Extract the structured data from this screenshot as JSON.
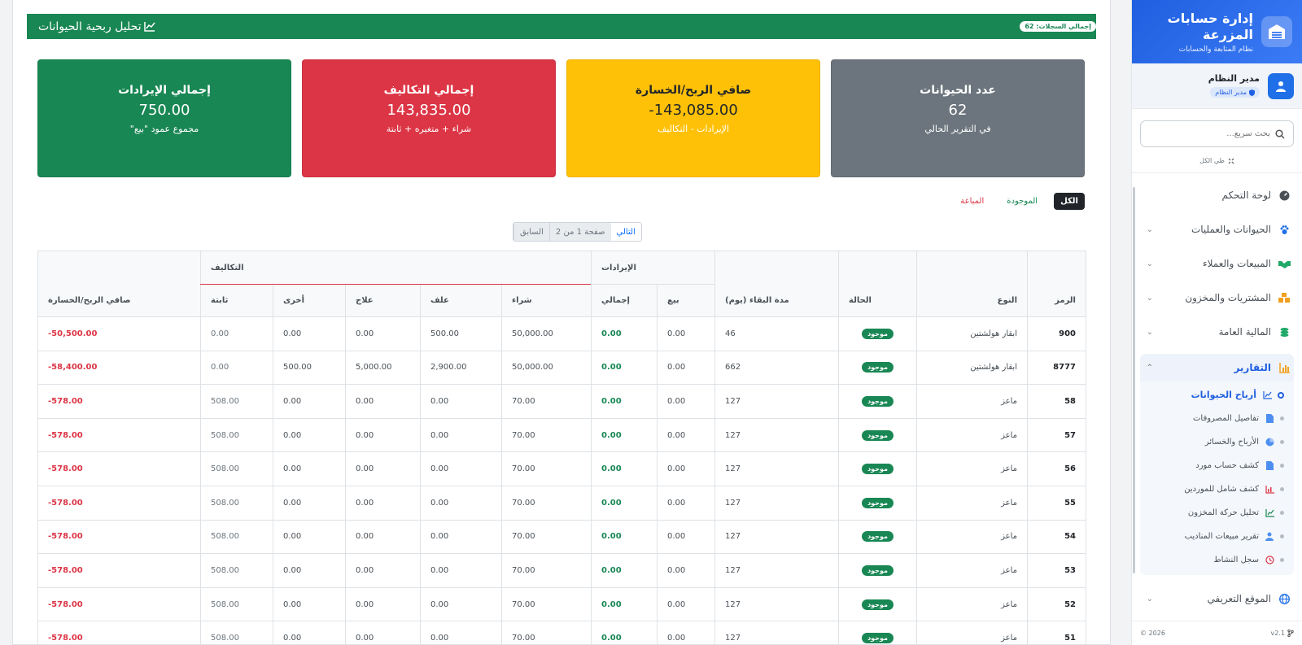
{
  "sidebar": {
    "brand_title": "إدارة حسابات المزرعة",
    "brand_subtitle": "نظام المتابعة والحسابات",
    "user_name": "مدير النظام",
    "user_role": "مدير النظام",
    "search_placeholder": "بحث سريع...",
    "collapse_all": "طي الكل",
    "menu": {
      "dashboard": "لوحة التحكم",
      "animals": "الحيوانات والعمليات",
      "sales": "المبيعات والعملاء",
      "purchases": "المشتريات والمخزون",
      "finance": "المالية العامة",
      "reports": "التقارير",
      "website": "الموقع التعريفي"
    },
    "reports_sub": [
      "أرباح الحيوانات",
      "تفاصيل المصروفات",
      "الأرباح والخسائر",
      "كشف حساب مورد",
      "كشف شامل للموردين",
      "تحليل حركة المخزون",
      "تقرير مبيعات المناديب",
      "سجل النشاط"
    ],
    "version": "v2.1",
    "copyright": "© 2026"
  },
  "header": {
    "title": "تحليل ربحية الحيوانات",
    "total_badge": "إجمالي السجلات: 62"
  },
  "cards": [
    {
      "title": "إجمالي الإيرادات",
      "value": "750.00",
      "sub": "مجموع عمود \"بيع\""
    },
    {
      "title": "إجمالي التكاليف",
      "value": "143,835.00",
      "sub": "شراء + متغيره + ثابتة"
    },
    {
      "title": "صافي الربح/الخسارة",
      "value": "-143,085.00",
      "sub": "الإيرادات - التكاليف"
    },
    {
      "title": "عدد الحيوانات",
      "value": "62",
      "sub": "في التقرير الحالي"
    }
  ],
  "filters": {
    "all": "الكل",
    "existing": "الموجودة",
    "sold": "المباعة"
  },
  "pager": {
    "prev": "السابق",
    "info": "صفحة 1 من 2",
    "next": "التالي"
  },
  "table": {
    "headers": {
      "code": "الرمز",
      "type": "النوع",
      "status": "الحالة",
      "days": "مدة البقاء (يوم)",
      "revenues": "الإيرادات",
      "costs": "التكاليف",
      "net": "صافي الربح/الخسارة",
      "sale": "بيع",
      "total": "إجمالي",
      "purchase": "شراء",
      "feed": "علف",
      "treatment": "علاج",
      "other": "أخرى",
      "fixed": "ثابتة"
    },
    "rows": [
      {
        "code": "900",
        "type": "ابقار هولشتين",
        "status": "موجود",
        "days": "46",
        "sale": "0.00",
        "total": "0.00",
        "purchase": "50,000.00",
        "feed": "500.00",
        "treatment": "0.00",
        "other": "0.00",
        "fixed": "0.00",
        "net": "-50,500.00"
      },
      {
        "code": "8777",
        "type": "ابقار هولشتين",
        "status": "موجود",
        "days": "662",
        "sale": "0.00",
        "total": "0.00",
        "purchase": "50,000.00",
        "feed": "2,900.00",
        "treatment": "5,000.00",
        "other": "500.00",
        "fixed": "0.00",
        "net": "-58,400.00"
      },
      {
        "code": "58",
        "type": "ماعز",
        "status": "موجود",
        "days": "127",
        "sale": "0.00",
        "total": "0.00",
        "purchase": "70.00",
        "feed": "0.00",
        "treatment": "0.00",
        "other": "0.00",
        "fixed": "508.00",
        "net": "-578.00"
      },
      {
        "code": "57",
        "type": "ماعز",
        "status": "موجود",
        "days": "127",
        "sale": "0.00",
        "total": "0.00",
        "purchase": "70.00",
        "feed": "0.00",
        "treatment": "0.00",
        "other": "0.00",
        "fixed": "508.00",
        "net": "-578.00"
      },
      {
        "code": "56",
        "type": "ماعز",
        "status": "موجود",
        "days": "127",
        "sale": "0.00",
        "total": "0.00",
        "purchase": "70.00",
        "feed": "0.00",
        "treatment": "0.00",
        "other": "0.00",
        "fixed": "508.00",
        "net": "-578.00"
      },
      {
        "code": "55",
        "type": "ماعز",
        "status": "موجود",
        "days": "127",
        "sale": "0.00",
        "total": "0.00",
        "purchase": "70.00",
        "feed": "0.00",
        "treatment": "0.00",
        "other": "0.00",
        "fixed": "508.00",
        "net": "-578.00"
      },
      {
        "code": "54",
        "type": "ماعز",
        "status": "موجود",
        "days": "127",
        "sale": "0.00",
        "total": "0.00",
        "purchase": "70.00",
        "feed": "0.00",
        "treatment": "0.00",
        "other": "0.00",
        "fixed": "508.00",
        "net": "-578.00"
      },
      {
        "code": "53",
        "type": "ماعز",
        "status": "موجود",
        "days": "127",
        "sale": "0.00",
        "total": "0.00",
        "purchase": "70.00",
        "feed": "0.00",
        "treatment": "0.00",
        "other": "0.00",
        "fixed": "508.00",
        "net": "-578.00"
      },
      {
        "code": "52",
        "type": "ماعز",
        "status": "موجود",
        "days": "127",
        "sale": "0.00",
        "total": "0.00",
        "purchase": "70.00",
        "feed": "0.00",
        "treatment": "0.00",
        "other": "0.00",
        "fixed": "508.00",
        "net": "-578.00"
      },
      {
        "code": "51",
        "type": "ماعز",
        "status": "موجود",
        "days": "127",
        "sale": "0.00",
        "total": "0.00",
        "purchase": "70.00",
        "feed": "0.00",
        "treatment": "0.00",
        "other": "0.00",
        "fixed": "508.00",
        "net": "-578.00"
      }
    ]
  }
}
